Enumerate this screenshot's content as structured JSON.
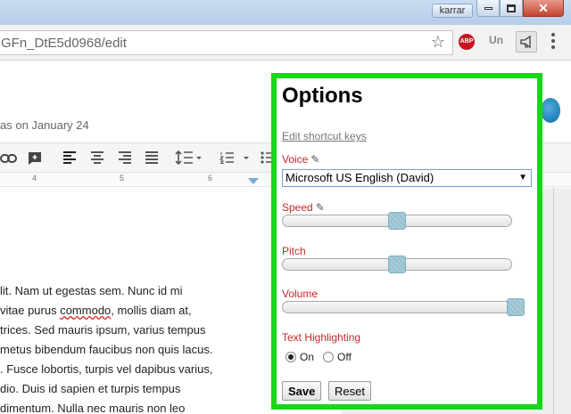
{
  "window": {
    "user": "karrar",
    "close_glyph": "✕"
  },
  "address_bar": {
    "url": "GFn_DtE5d0968/edit",
    "star_icon": "☆"
  },
  "extensions": {
    "abp": "ABP",
    "un": "Un"
  },
  "doc": {
    "saved_text": "as on January 24",
    "ruler_numbers": [
      "4",
      "5",
      "6"
    ],
    "lines": [
      "lit. Nam ut egestas sem. Nunc id mi",
      "vitae purus ",
      "trices. Sed mauris ipsum, varius tempus",
      " metus bibendum faucibus non quis lacus.",
      ". Fusce lobortis, turpis vel dapibus varius,",
      "dio. Duis id sapien et turpis tempus",
      "dimentum. Nulla nec mauris non leo"
    ],
    "misspelled": "commodo",
    "line2_rest": ", mollis diam at,"
  },
  "options": {
    "title": "Options",
    "shortcut_link": "Edit shortcut keys",
    "voice_label": "Voice",
    "voice_value": "Microsoft US English (David)",
    "speed_label": "Speed",
    "speed_value": 0.5,
    "pitch_label": "Pitch",
    "pitch_value": 0.5,
    "volume_label": "Volume",
    "volume_value": 1.0,
    "highlight_label": "Text Highlighting",
    "on_label": "On",
    "off_label": "Off",
    "highlight_selected": "On",
    "save_label": "Save",
    "reset_label": "Reset",
    "accent_color": "#18d61a",
    "label_color": "#c3272b"
  }
}
